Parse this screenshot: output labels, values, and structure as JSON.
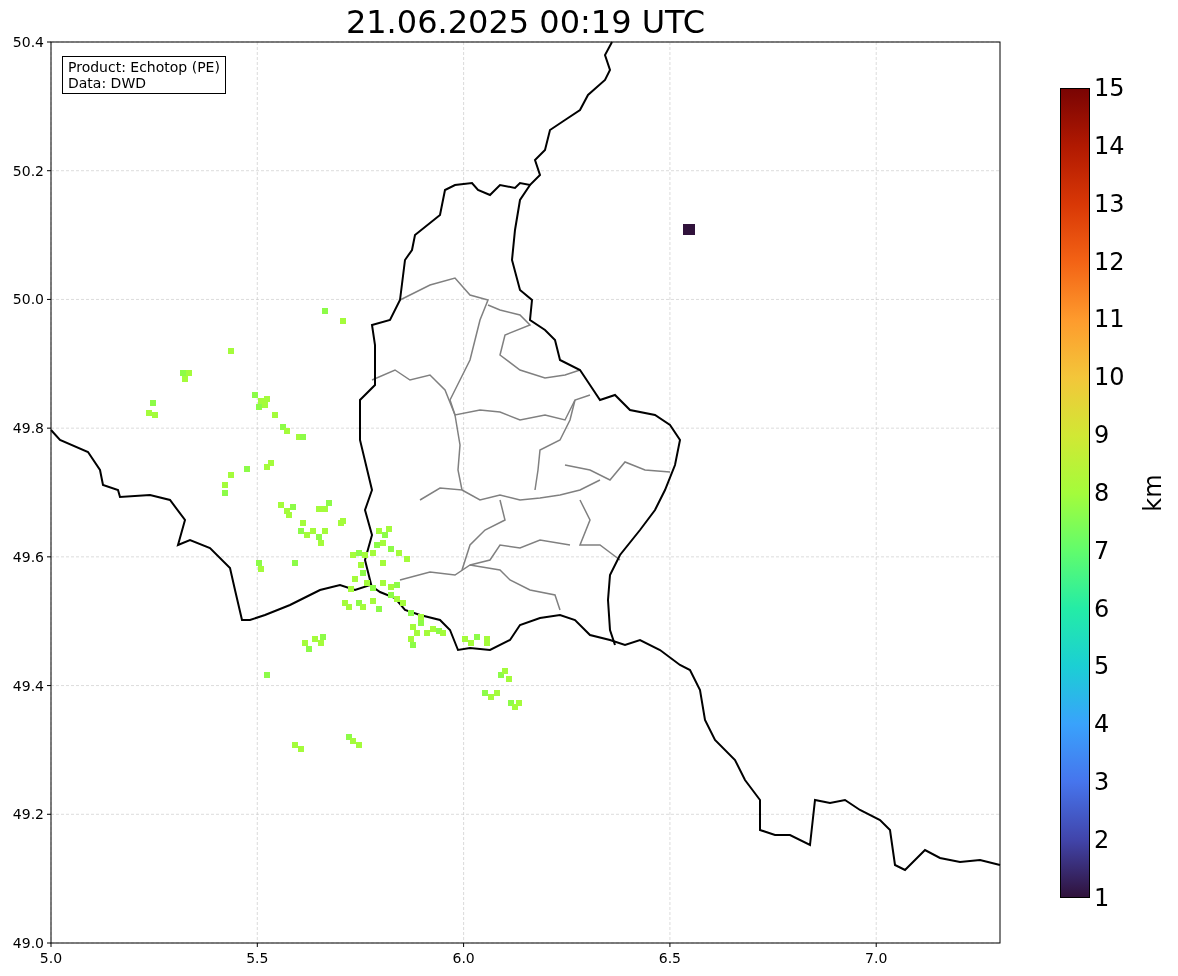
{
  "title": "21.06.2025 00:19 UTC",
  "map": {
    "info_box": [
      "Product: Echotop (PE)",
      "Data: DWD"
    ],
    "xticks": [
      "5.0",
      "5.5",
      "6.0",
      "6.5",
      "7.0"
    ],
    "yticks": [
      "50.4",
      "50.2",
      "50.0",
      "49.8",
      "49.6",
      "49.4",
      "49.2",
      "49.0"
    ]
  },
  "colorbar": {
    "label": "km",
    "ticks": [
      "15",
      "14",
      "13",
      "12",
      "11",
      "10",
      "9",
      "8",
      "7",
      "6",
      "5",
      "4",
      "3",
      "2",
      "1"
    ]
  }
}
